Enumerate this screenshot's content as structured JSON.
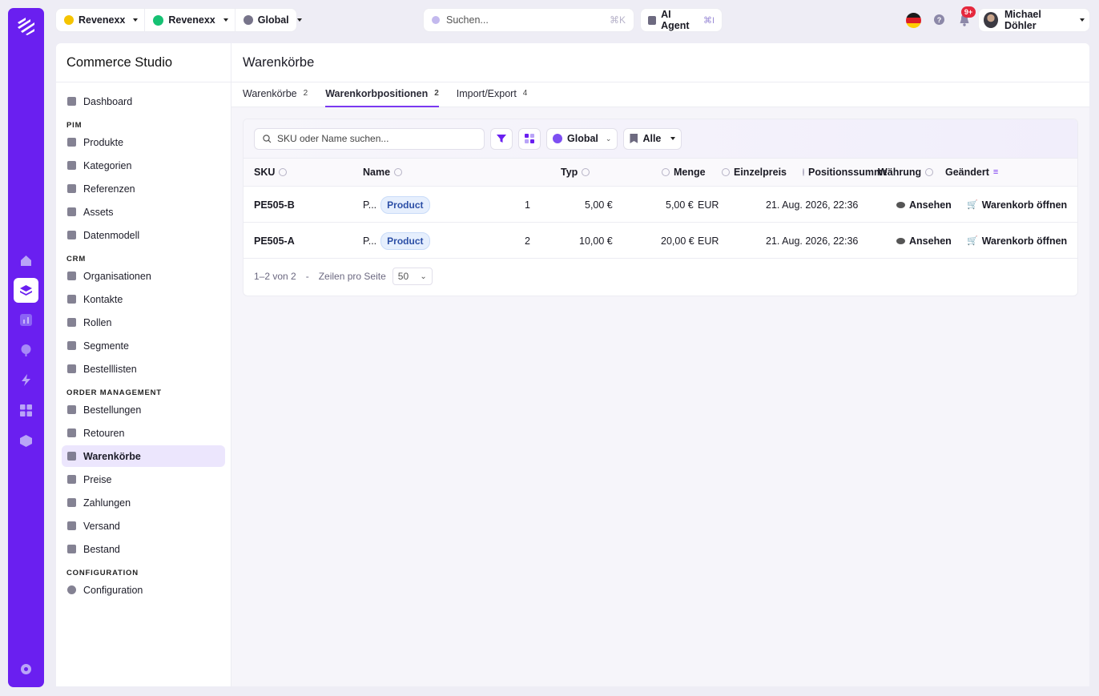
{
  "topbar": {
    "org1": "Revenexx",
    "org2": "Revenexx",
    "scope": "Global",
    "search_placeholder": "Suchen...",
    "search_shortcut": "⌘K",
    "ai_agent_label": "AI Agent",
    "ai_agent_shortcut": "⌘I",
    "notifications_badge": "9+",
    "user_name": "Michael Döhler"
  },
  "sidebar": {
    "title": "Commerce Studio",
    "dashboard": "Dashboard",
    "sections": {
      "pim": "PIM",
      "crm": "CRM",
      "order": "ORDER MANAGEMENT",
      "config": "CONFIGURATION"
    },
    "pim_items": [
      "Produkte",
      "Kategorien",
      "Referenzen",
      "Assets",
      "Datenmodell"
    ],
    "crm_items": [
      "Organisationen",
      "Kontakte",
      "Rollen",
      "Segmente",
      "Bestelllisten"
    ],
    "order_items": [
      "Bestellungen",
      "Retouren",
      "Warenkörbe",
      "Preise",
      "Zahlungen",
      "Versand",
      "Bestand"
    ],
    "config_items": [
      "Configuration"
    ]
  },
  "page": {
    "title": "Warenkörbe",
    "tabs": [
      {
        "label": "Warenkörbe",
        "count": "2"
      },
      {
        "label": "Warenkorbpositionen",
        "count": "2"
      },
      {
        "label": "Import/Export",
        "count": "4"
      }
    ]
  },
  "toolbar": {
    "search_placeholder": "SKU oder Name suchen...",
    "scope": "Global",
    "filter": "Alle"
  },
  "table": {
    "headers": {
      "sku": "SKU",
      "name": "Name",
      "typ": "Typ",
      "menge": "Menge",
      "einzelpreis": "Einzelpreis",
      "positionssumme": "Positionssumme",
      "waehrung": "Währung",
      "geaendert": "Geändert"
    },
    "rows": [
      {
        "sku": "PE505-B",
        "name": "P...",
        "typ": "Product",
        "menge": "1",
        "einzelpreis": "5,00 €",
        "positionssumme": "5,00 €",
        "waehrung": "EUR",
        "geaendert": "21. Aug. 2026, 22:36",
        "view": "Ansehen",
        "open": "Warenkorb öffnen"
      },
      {
        "sku": "PE505-A",
        "name": "P...",
        "typ": "Product",
        "menge": "2",
        "einzelpreis": "10,00 €",
        "positionssumme": "20,00 €",
        "waehrung": "EUR",
        "geaendert": "21. Aug. 2026, 22:36",
        "view": "Ansehen",
        "open": "Warenkorb öffnen"
      }
    ]
  },
  "pagination": {
    "range": "1–2 von 2",
    "separator": "-",
    "per_page_label": "Zeilen pro Seite",
    "per_page": "50"
  }
}
